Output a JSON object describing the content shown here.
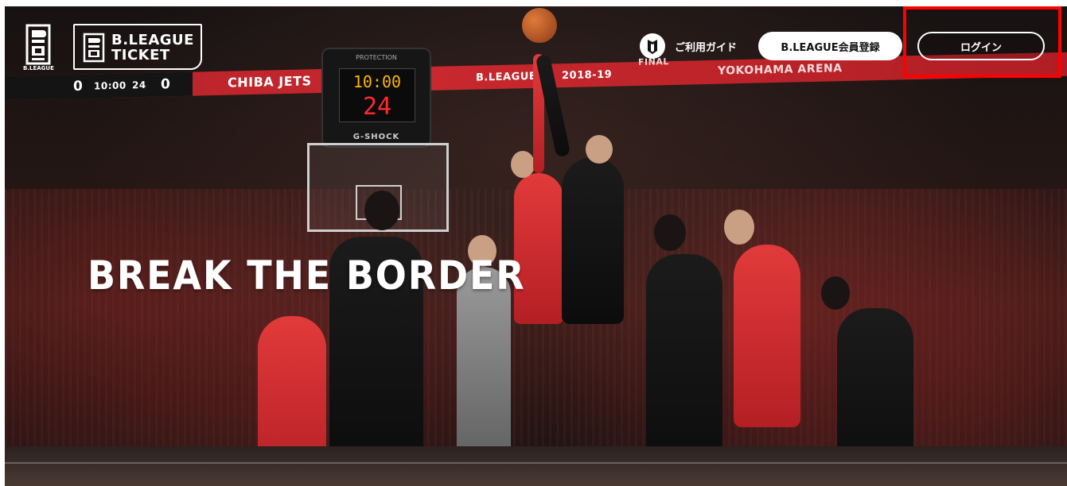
{
  "header": {
    "bleague_label": "B.LEAGUE",
    "ticket_logo_line1": "B.LEAGUE",
    "ticket_logo_line2": "TICKET",
    "guide_label": "ご利用ガイド",
    "register_label": "B.LEAGUE会員登録",
    "login_label": "ログイン"
  },
  "hero": {
    "headline": "BREAK THE BORDER"
  },
  "scene": {
    "banner_left_score": "0",
    "banner_clock": "10:00",
    "banner_shot": "24",
    "banner_right_score": "0",
    "banner_team": "CHIBA JETS",
    "banner_league": "B.LEAGUE",
    "banner_season": "2018-19",
    "banner_final": "FINAL",
    "banner_venue": "YOKOHAMA ARENA",
    "shotclock_top": "PROTECTION",
    "shotclock_time": "10:00",
    "shotclock_shot": "24",
    "shotclock_brand": "G-SHOCK"
  },
  "colors": {
    "accent_red": "#c8282e",
    "highlight_red": "#ff0000",
    "button_white": "#ffffff"
  },
  "icons": [
    "bleague-logo-icon",
    "ticket-logo-icon",
    "guide-shield-icon"
  ]
}
